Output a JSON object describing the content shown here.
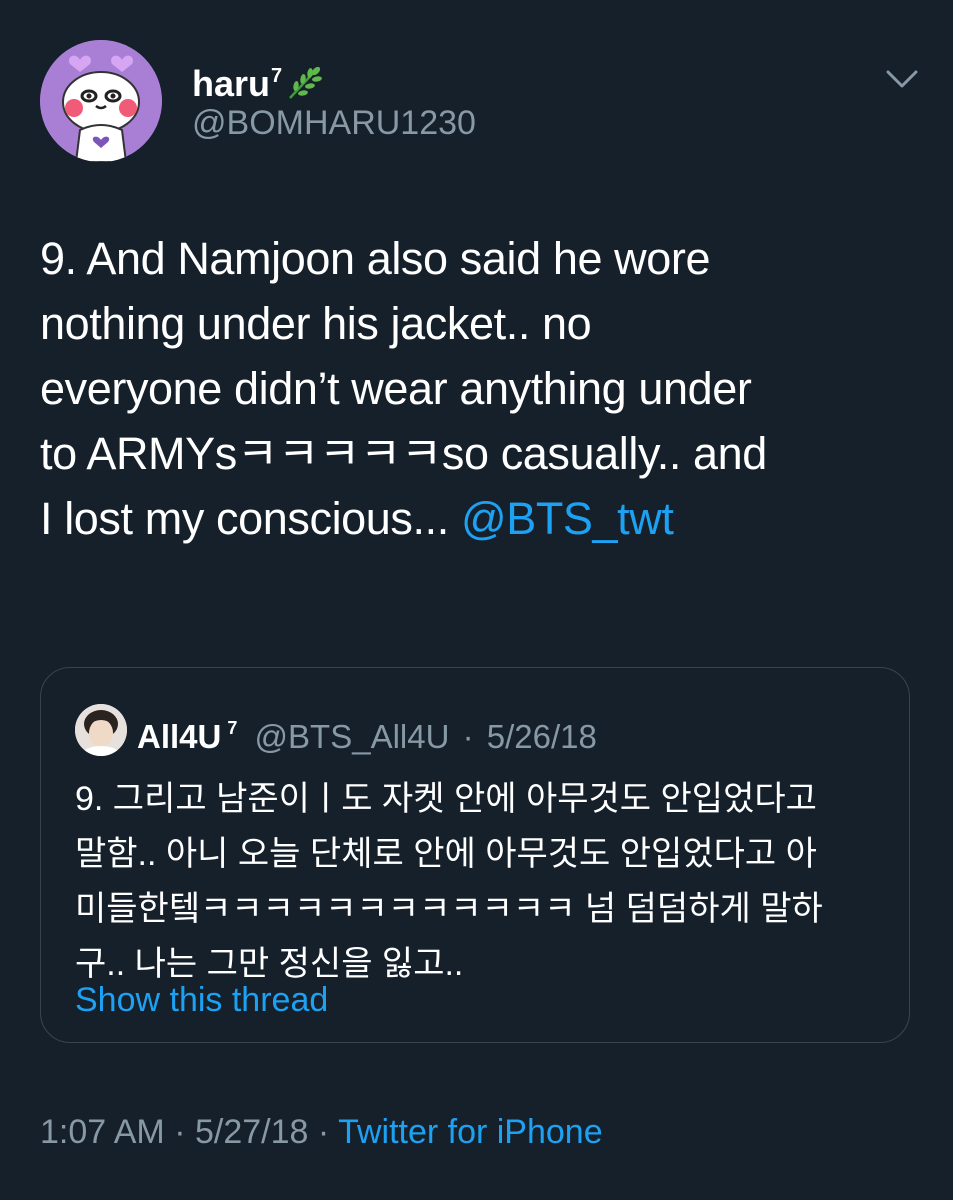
{
  "tweet": {
    "author": {
      "display_name": "haru",
      "name_superscript": "7",
      "name_emoji": "leaf-icon",
      "handle": "@BOMHARU1230"
    },
    "menu_icon": "chevron-down-icon",
    "text_lines": [
      "9. And Namjoon also said he wore",
      "nothing under his jacket.. no",
      "everyone didn’t wear anything under",
      "to ARMYsㅋㅋㅋㅋㅋso casually.. and"
    ],
    "last_line_text": "I lost my conscious... ",
    "mention": "@BTS_twt",
    "quote": {
      "display_name": "All4U",
      "name_superscript": "7",
      "handle": "@BTS_All4U",
      "separator": "·",
      "date": "5/26/18",
      "text_lines": [
        "9. 그리고 남준이ㅣ도 자켓 안에 아무것도 안입었다고",
        "말함.. 아니 오늘 단체로 안에 아무것도 안입었다고 아",
        "미들한텤ㅋㅋㅋㅋㅋㅋㅋㅋㅋㅋㅋㅋ 넘 덤덤하게 말하",
        "구.. 나는 그만 정신을 잃고.."
      ],
      "show_thread": "Show this thread"
    },
    "footer": {
      "time": "1:07 AM",
      "separator": "·",
      "date": "5/27/18",
      "source": "Twitter for iPhone"
    }
  },
  "colors": {
    "background": "#15202b",
    "text": "#ffffff",
    "secondary": "#8899a6",
    "link": "#1da1f2",
    "border": "#38444d"
  }
}
